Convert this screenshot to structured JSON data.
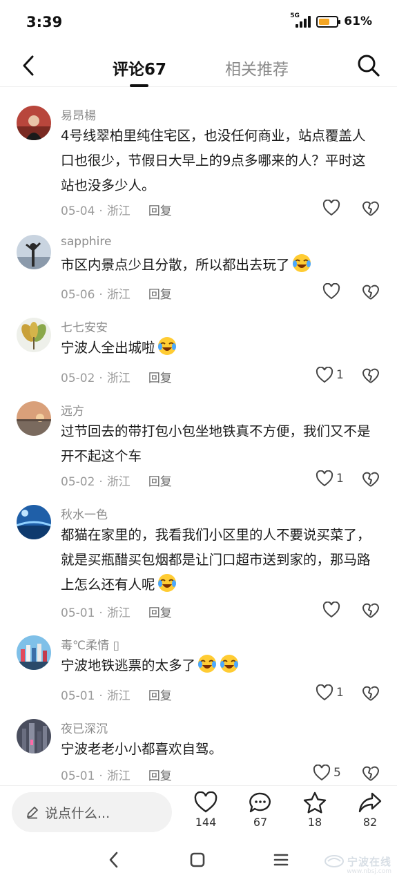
{
  "status_bar": {
    "time": "3:39",
    "network": "5G",
    "battery_percent": "61%",
    "battery_level": 0.61
  },
  "nav": {
    "tab_comments": "评论67",
    "tab_related": "相关推荐"
  },
  "comments": [
    {
      "name": "易昂楊",
      "text": "4号线翠柏里纯住宅区，也没任何商业，站点覆盖人口也很少，节假日大早上的9点多哪来的人？平时这站也没多少人。",
      "date": "05-04",
      "location": "浙江",
      "reply": "回复",
      "likes": "",
      "emoji_count": 0
    },
    {
      "name": "sapphire",
      "text": "市区内景点少且分散，所以都出去玩了",
      "date": "05-06",
      "location": "浙江",
      "reply": "回复",
      "likes": "",
      "emoji_count": 1
    },
    {
      "name": "七七安安",
      "text": "宁波人全出城啦",
      "date": "05-02",
      "location": "浙江",
      "reply": "回复",
      "likes": "1",
      "emoji_count": 1
    },
    {
      "name": "远方",
      "text": "过节回去的带打包小包坐地铁真不方便，我们又不是开不起这个车",
      "date": "05-02",
      "location": "浙江",
      "reply": "回复",
      "likes": "1",
      "emoji_count": 0
    },
    {
      "name": "秋水一色",
      "text": "都猫在家里的，我看我们小区里的人不要说买菜了，就是买瓶醋买包烟都是让门口超市送到家的，那马路上怎么还有人呢",
      "date": "05-01",
      "location": "浙江",
      "reply": "回复",
      "likes": "",
      "emoji_count": 1
    },
    {
      "name": "毒℃柔情 ▯",
      "text": "宁波地铁逃票的太多了",
      "date": "05-01",
      "location": "浙江",
      "reply": "回复",
      "likes": "1",
      "emoji_count": 2
    },
    {
      "name": "夜已深沉",
      "text": "宁波老老小小都喜欢自驾。",
      "date": "05-01",
      "location": "浙江",
      "reply": "回复",
      "likes": "5",
      "emoji_count": 0
    }
  ],
  "bottom_bar": {
    "input_placeholder": "说点什么...",
    "like_count": "144",
    "comment_count": "67",
    "favorite_count": "18",
    "share_count": "82"
  },
  "watermark": {
    "text": "宁波在线",
    "url": "www.nbsj.com"
  },
  "colors": {
    "accent_battery": "#f5a623",
    "text_primary": "#1a1a1a",
    "text_secondary": "#8a8a8a"
  }
}
